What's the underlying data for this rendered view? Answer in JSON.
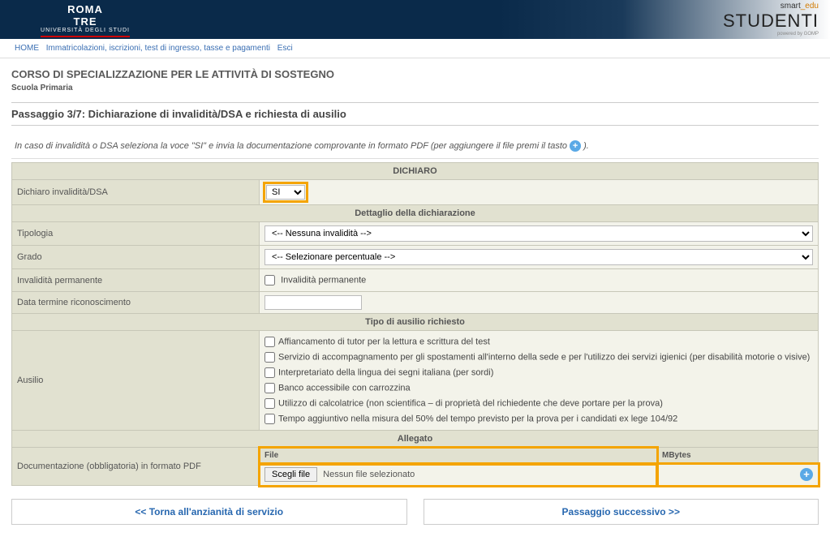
{
  "brand": {
    "uni_top": "ROMA",
    "uni_mid": "TRE",
    "uni_sub": "UNIVERSITÀ DEGLI STUDI",
    "right_small_a": "smart",
    "right_small_b": "_edu",
    "right_big": "STUDENTI",
    "right_pow": "powered by GOMP"
  },
  "crumbs": {
    "home": "HOME",
    "c2": "Immatricolazioni, iscrizioni, test di ingresso, tasse e pagamenti",
    "c3": "Esci"
  },
  "page": {
    "title": "CORSO DI SPECIALIZZAZIONE PER LE ATTIVITÀ DI SOSTEGNO",
    "subtitle": "Scuola Primaria",
    "step": "Passaggio 3/7: Dichiarazione di invalidità/DSA e richiesta di ausilio",
    "intro_a": "In caso di invalidità o DSA seleziona la voce \"SI\" e invia la documentazione comprovante in formato PDF (per aggiungere il file premi il tasto ",
    "intro_b": ")."
  },
  "sections": {
    "dichiaro": "DICHIARO",
    "dettaglio": "Dettaglio della dichiarazione",
    "tipo_ausilio": "Tipo di ausilio richiesto",
    "allegato": "Allegato"
  },
  "labels": {
    "dich_inv": "Dichiaro invalidità/DSA",
    "tipologia": "Tipologia",
    "grado": "Grado",
    "inv_perm": "Invalidità permanente",
    "data_term": "Data termine riconoscimento",
    "ausilio": "Ausilio",
    "doc_pdf": "Documentazione (obbligatoria) in formato PDF",
    "file_col": "File",
    "mb_col": "MBytes"
  },
  "values": {
    "si_select": "SI",
    "tipologia_sel": "<-- Nessuna invalidità -->",
    "grado_sel": "<-- Selezionare percentuale -->",
    "inv_perm_chk": "Invalidità permanente",
    "file_btn": "Scegli file",
    "file_status": "Nessun file selezionato"
  },
  "ausilio_opts": [
    "Affiancamento di tutor per la lettura e scrittura del test",
    "Servizio di accompagnamento per gli spostamenti all'interno della sede e per l'utilizzo dei servizi igienici (per disabilità motorie o visive)",
    "Interpretariato della lingua dei segni italiana (per sordi)",
    "Banco accessibile con carrozzina",
    "Utilizzo di calcolatrice (non scientifica – di proprietà del richiedente che deve portare per la prova)",
    "Tempo aggiuntivo nella misura del 50% del tempo previsto per la prova per i candidati ex lege 104/92"
  ],
  "nav": {
    "prev": "<< Torna all'anzianità di servizio",
    "next": "Passaggio successivo >>"
  }
}
